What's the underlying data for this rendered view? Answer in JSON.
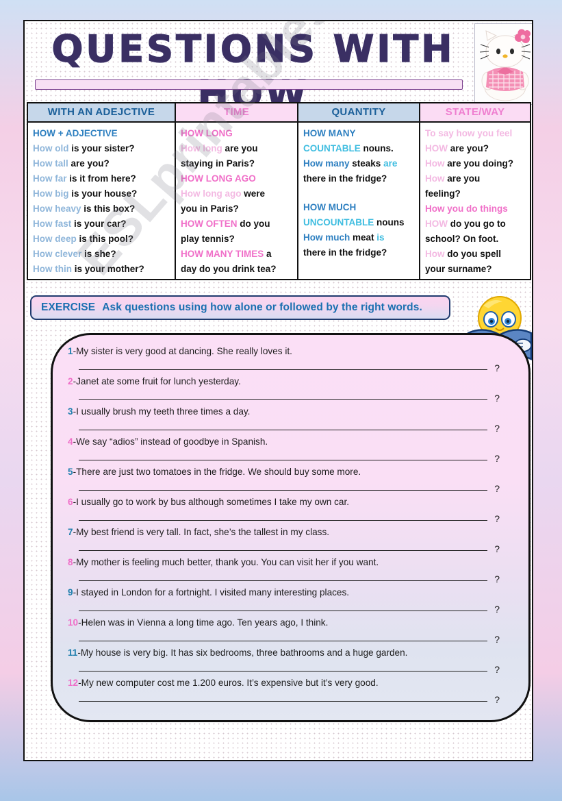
{
  "title": "QUESTIONS WITH HOW",
  "watermark": "ESLprintables.com",
  "icons": {
    "kitty": "hello-kitty-plush-photo",
    "reader": "smiley-reading-book-icon"
  },
  "colors": {
    "header_blue_bg": "#c6d7ea",
    "header_blue_text": "#1b5f99",
    "header_pink_bg": "#fbdcf4",
    "header_pink_text": "#ef7fd0",
    "strong_blue": "#2d7fc0",
    "faded_blue": "#8fb6da",
    "cyan": "#3fbde0",
    "strong_pink": "#f06fc8",
    "faded_pink": "#f3b9e2",
    "instruction_text": "#1a6fb0",
    "instruction_border": "#1f3a6e"
  },
  "table": {
    "columns": [
      {
        "header": "WITH AN ADEJCTIVE",
        "header_style": "blue",
        "lines": [
          [
            {
              "t": "HOW + ADJECTIVE",
              "c": "bl"
            }
          ],
          [
            {
              "t": "How old ",
              "c": "bl-l"
            },
            {
              "t": "is your sister?",
              "c": "bk"
            }
          ],
          [
            {
              "t": "How tall ",
              "c": "bl-l"
            },
            {
              "t": "are you?",
              "c": "bk"
            }
          ],
          [
            {
              "t": "How far ",
              "c": "bl-l"
            },
            {
              "t": "is it from here?",
              "c": "bk"
            }
          ],
          [
            {
              "t": "How big ",
              "c": "bl-l"
            },
            {
              "t": "is your house?",
              "c": "bk"
            }
          ],
          [
            {
              "t": "How heavy ",
              "c": "bl-l"
            },
            {
              "t": "is this box?",
              "c": "bk"
            }
          ],
          [
            {
              "t": "How fast ",
              "c": "bl-l"
            },
            {
              "t": "is your car?",
              "c": "bk"
            }
          ],
          [
            {
              "t": "How deep ",
              "c": "bl-l"
            },
            {
              "t": "is this pool?",
              "c": "bk"
            }
          ],
          [
            {
              "t": "How clever ",
              "c": "bl-l"
            },
            {
              "t": "is she?",
              "c": "bk"
            }
          ],
          [
            {
              "t": "How thin ",
              "c": "bl-l"
            },
            {
              "t": "is your mother?",
              "c": "bk"
            }
          ]
        ]
      },
      {
        "header": "TIME",
        "header_style": "pink",
        "lines": [
          [
            {
              "t": "HOW LONG",
              "c": "pk"
            }
          ],
          [
            {
              "t": "How long ",
              "c": "pk-l"
            },
            {
              "t": "are you",
              "c": "bk"
            }
          ],
          [
            {
              "t": "staying in Paris?",
              "c": "bk"
            }
          ],
          [
            {
              "t": "HOW LONG AGO",
              "c": "pk"
            }
          ],
          [
            {
              "t": "How long ago ",
              "c": "pk-l"
            },
            {
              "t": "were",
              "c": "bk"
            }
          ],
          [
            {
              "t": "you in Paris?",
              "c": "bk"
            }
          ],
          [
            {
              "t": "HOW OFTEN ",
              "c": "pk"
            },
            {
              "t": "do you",
              "c": "bk"
            }
          ],
          [
            {
              "t": "play tennis?",
              "c": "bk"
            }
          ],
          [
            {
              "t": "HOW MANY TIMES ",
              "c": "pk"
            },
            {
              "t": "a",
              "c": "bk"
            }
          ],
          [
            {
              "t": "day do you drink tea?",
              "c": "bk"
            }
          ]
        ]
      },
      {
        "header": "QUANTITY",
        "header_style": "blue",
        "lines": [
          [
            {
              "t": "HOW MANY",
              "c": "bl"
            }
          ],
          [
            {
              "t": "COUNTABLE ",
              "c": "cy"
            },
            {
              "t": "nouns.",
              "c": "bk"
            }
          ],
          [
            {
              "t": "How many ",
              "c": "bl"
            },
            {
              "t": "steaks ",
              "c": "bk"
            },
            {
              "t": "are",
              "c": "cy"
            }
          ],
          [
            {
              "t": "there in the fridge?",
              "c": "bk"
            }
          ],
          [
            {
              "t": "",
              "c": "bk"
            }
          ],
          [
            {
              "t": "HOW MUCH",
              "c": "bl"
            }
          ],
          [
            {
              "t": "UNCOUNTABLE ",
              "c": "cy"
            },
            {
              "t": "nouns",
              "c": "bk"
            }
          ],
          [
            {
              "t": "How much ",
              "c": "bl"
            },
            {
              "t": "meat ",
              "c": "bk"
            },
            {
              "t": "is",
              "c": "cy"
            }
          ],
          [
            {
              "t": "there in the fridge?",
              "c": "bk"
            }
          ]
        ]
      },
      {
        "header": "STATE/WAY",
        "header_style": "pink",
        "lines": [
          [
            {
              "t": "To say how you feel",
              "c": "pk-l"
            }
          ],
          [
            {
              "t": "HOW ",
              "c": "pk-l"
            },
            {
              "t": "are you?",
              "c": "bk"
            }
          ],
          [
            {
              "t": "How ",
              "c": "pk-l"
            },
            {
              "t": "are you doing?",
              "c": "bk"
            }
          ],
          [
            {
              "t": "How ",
              "c": "pk-l"
            },
            {
              "t": "are you",
              "c": "bk"
            }
          ],
          [
            {
              "t": "feeling?",
              "c": "bk"
            }
          ],
          [
            {
              "t": "How you do things",
              "c": "pk"
            }
          ],
          [
            {
              "t": "HOW ",
              "c": "pk-l"
            },
            {
              "t": "do you go to",
              "c": "bk"
            }
          ],
          [
            {
              "t": "school? On foot.",
              "c": "bk"
            }
          ],
          [
            {
              "t": "How ",
              "c": "pk-l"
            },
            {
              "t": "do you spell",
              "c": "bk"
            }
          ],
          [
            {
              "t": "your surname?",
              "c": "bk"
            }
          ]
        ]
      }
    ]
  },
  "exercise": {
    "label": "EXERCISE",
    "instruction": "Ask questions using how alone or followed by the right words.",
    "answer_mark": "?",
    "items": [
      {
        "n": "1",
        "text": "-My sister is very good at dancing. She really loves it."
      },
      {
        "n": "2",
        "text": "-Janet ate some fruit for lunch yesterday."
      },
      {
        "n": "3",
        "text": "-I usually brush my teeth three times a day."
      },
      {
        "n": "4",
        "text": "-We say “adios” instead of goodbye in Spanish."
      },
      {
        "n": "5",
        "text": "-There are just two tomatoes in the fridge. We should buy some more."
      },
      {
        "n": "6",
        "text": "-I usually go to work by bus although sometimes I take my own car."
      },
      {
        "n": "7",
        "text": "-My best friend is very tall. In fact, she’s the tallest in my class."
      },
      {
        "n": "8",
        "text": "-My mother is feeling much better, thank you. You can visit her if you want."
      },
      {
        "n": "9",
        "text": "-I stayed in London for a fortnight. I visited many interesting places."
      },
      {
        "n": "10",
        "text": "-Helen was in Vienna a long time ago. Ten years ago, I think."
      },
      {
        "n": "11",
        "text": "-My house is very big. It has six bedrooms, three bathrooms and a huge garden."
      },
      {
        "n": "12",
        "text": "-My new computer cost me 1.200 euros. It’s expensive but it’s very good."
      }
    ]
  }
}
